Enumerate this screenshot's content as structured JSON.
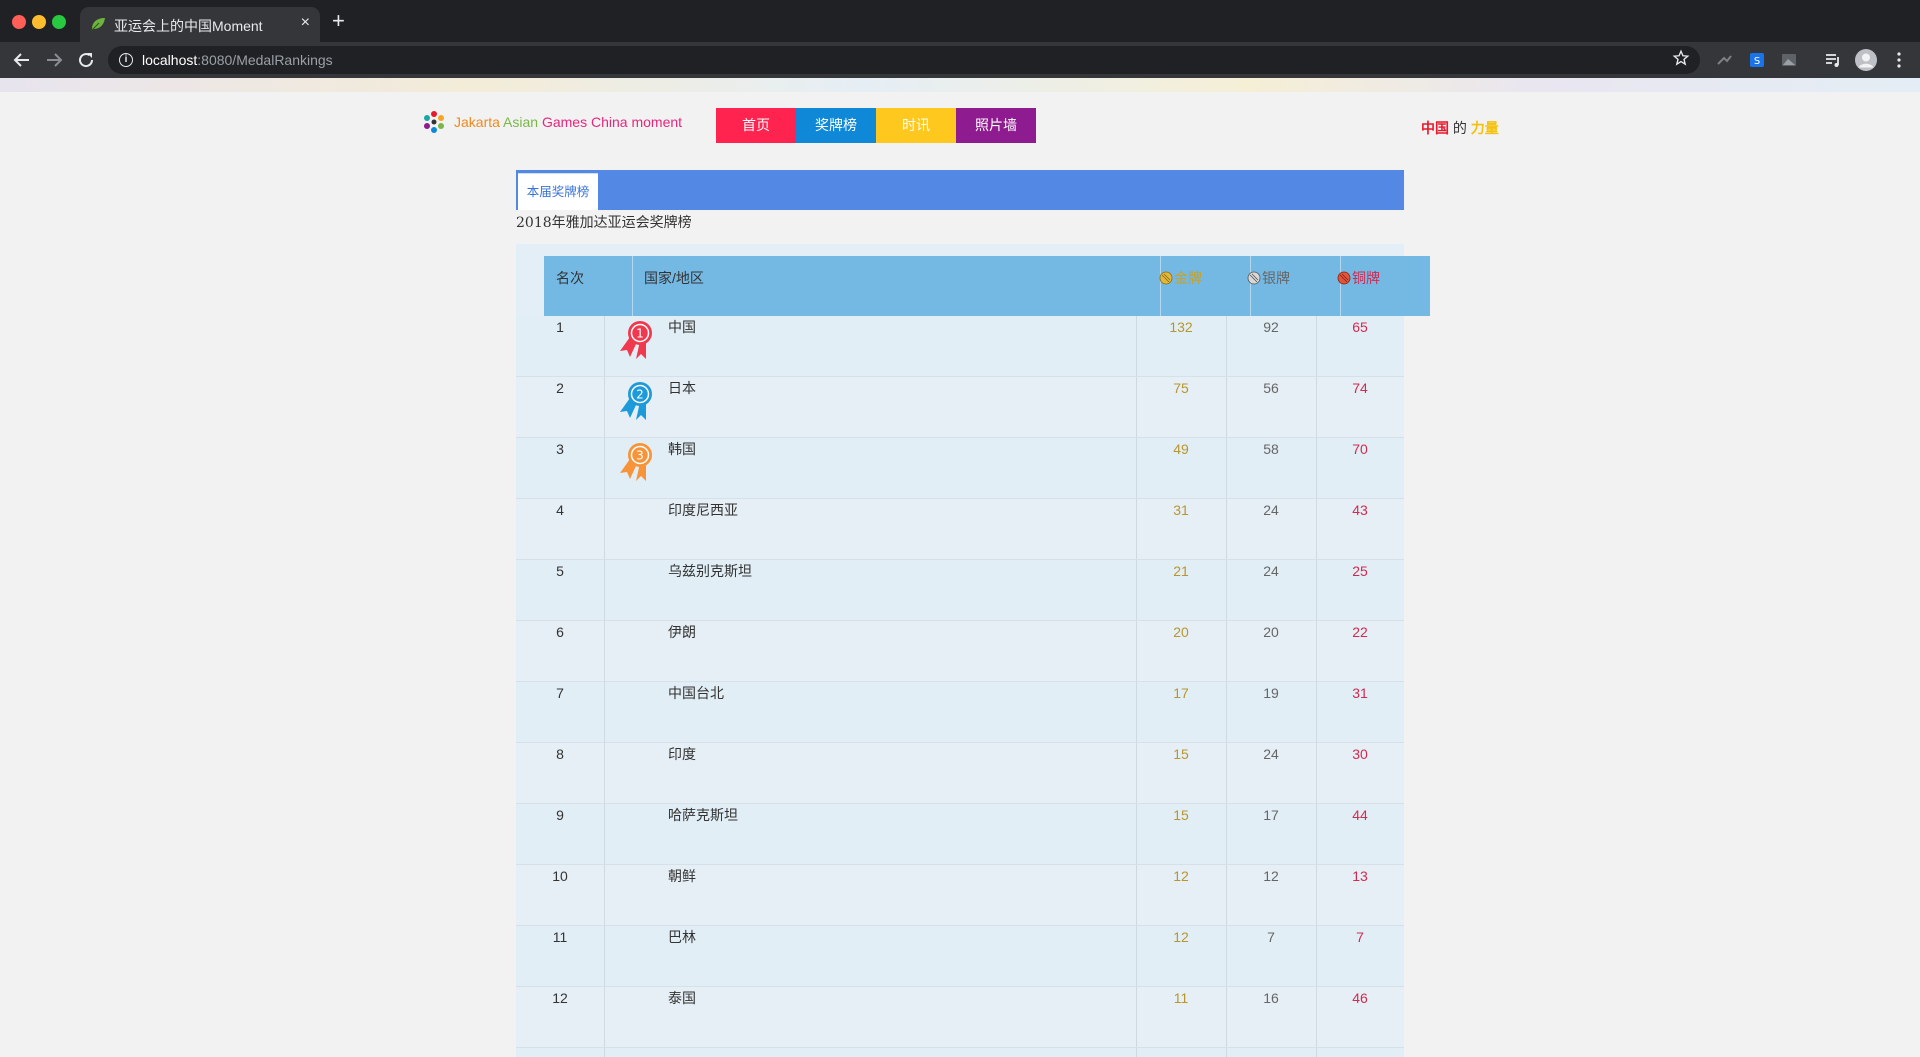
{
  "browser": {
    "tab_title": "亚运会上的中国Moment",
    "tab_close": "×",
    "new_tab": "+",
    "url_host": "localhost",
    "url_rest": ":8080/MedalRankings",
    "info_glyph": "i"
  },
  "header": {
    "brand_words": [
      "Jakarta",
      "Asian",
      "Games",
      "China",
      "moment"
    ],
    "nav": [
      "首页",
      "奖牌榜",
      "时讯",
      "照片墙"
    ],
    "slogan": [
      "中国",
      "的",
      "力量"
    ]
  },
  "tabs": {
    "active": "本届奖牌榜"
  },
  "subtitle": "2018年雅加达亚运会奖牌榜",
  "table": {
    "headers": {
      "rank": "名次",
      "country": "国家/地区",
      "gold": "金牌",
      "silver": "银牌",
      "bronze": "铜牌"
    },
    "colors": {
      "gold": "#b8962e",
      "silver": "#666666",
      "bronze": "#d22a4f",
      "header_bg": "#74b8e4"
    },
    "rows": [
      {
        "rank": "1",
        "country": "中国",
        "gold": "132",
        "silver": "92",
        "bronze": "65",
        "ribbon": "1"
      },
      {
        "rank": "2",
        "country": "日本",
        "gold": "75",
        "silver": "56",
        "bronze": "74",
        "ribbon": "2"
      },
      {
        "rank": "3",
        "country": "韩国",
        "gold": "49",
        "silver": "58",
        "bronze": "70",
        "ribbon": "3"
      },
      {
        "rank": "4",
        "country": "印度尼西亚",
        "gold": "31",
        "silver": "24",
        "bronze": "43"
      },
      {
        "rank": "5",
        "country": "乌兹别克斯坦",
        "gold": "21",
        "silver": "24",
        "bronze": "25"
      },
      {
        "rank": "6",
        "country": "伊朗",
        "gold": "20",
        "silver": "20",
        "bronze": "22"
      },
      {
        "rank": "7",
        "country": "中国台北",
        "gold": "17",
        "silver": "19",
        "bronze": "31"
      },
      {
        "rank": "8",
        "country": "印度",
        "gold": "15",
        "silver": "24",
        "bronze": "30"
      },
      {
        "rank": "9",
        "country": "哈萨克斯坦",
        "gold": "15",
        "silver": "17",
        "bronze": "44"
      },
      {
        "rank": "10",
        "country": "朝鲜",
        "gold": "12",
        "silver": "12",
        "bronze": "13"
      },
      {
        "rank": "11",
        "country": "巴林",
        "gold": "12",
        "silver": "7",
        "bronze": "7"
      },
      {
        "rank": "12",
        "country": "泰国",
        "gold": "11",
        "silver": "16",
        "bronze": "46"
      }
    ],
    "ribbon_colors": {
      "1": "#f0384e",
      "2": "#1d9ad9",
      "3": "#f7943a"
    }
  }
}
